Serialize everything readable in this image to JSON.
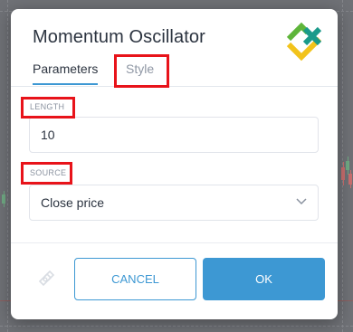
{
  "dialog": {
    "title": "Momentum Oscillator",
    "logo": "brand-logo-icon"
  },
  "tabs": [
    {
      "label": "Parameters",
      "active": true
    },
    {
      "label": "Style",
      "active": false
    }
  ],
  "fields": {
    "length": {
      "label": "LENGTH",
      "value": "10"
    },
    "source": {
      "label": "SOURCE",
      "value": "Close price"
    }
  },
  "footer": {
    "template_icon": "template-icon",
    "cancel_label": "CANCEL",
    "ok_label": "OK"
  },
  "colors": {
    "accent": "#3d98d3",
    "highlight": "#e8131a",
    "logo_green": "#5eb53a",
    "logo_yellow": "#f2c31b",
    "logo_teal": "#1a9a8a"
  }
}
